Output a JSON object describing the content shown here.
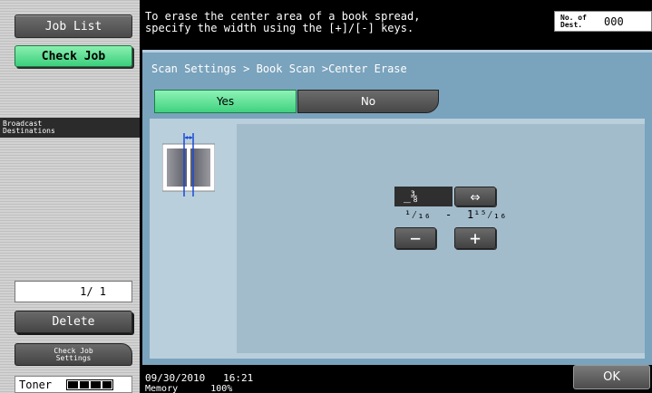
{
  "sidebar": {
    "job_list": "Job List",
    "check_job": "Check Job",
    "broadcast_line1": "Broadcast",
    "broadcast_line2": "Destinations",
    "page_counter": "1/ 1",
    "delete": "Delete",
    "check_settings_line1": "Check Job",
    "check_settings_line2": "Settings",
    "toner_label": "Toner",
    "toner_level": "4 of 4"
  },
  "header": {
    "message": "To erase the center area of a book spread,\nspecify the width using the [+]/[-] keys.",
    "dest_label_line1": "No. of",
    "dest_label_line2": "Dest.",
    "dest_value": "000"
  },
  "panel": {
    "breadcrumb": "Scan Settings > Book Scan >Center Erase",
    "yes": "Yes",
    "no": "No",
    "selected": "Yes"
  },
  "value": {
    "current": "_⅜",
    "range_min": "¹⁄₁₆",
    "range_sep": "-",
    "range_max": "1¹⁵⁄₁₆",
    "minus": "−",
    "plus": "+",
    "expand_icon": "⇔"
  },
  "footer": {
    "datetime": "09/30/2010   16:21",
    "memory": "Memory      100%",
    "ok": "OK"
  },
  "colors": {
    "accent_green": "#40d27f",
    "panel_blue": "#7aa3bd"
  }
}
